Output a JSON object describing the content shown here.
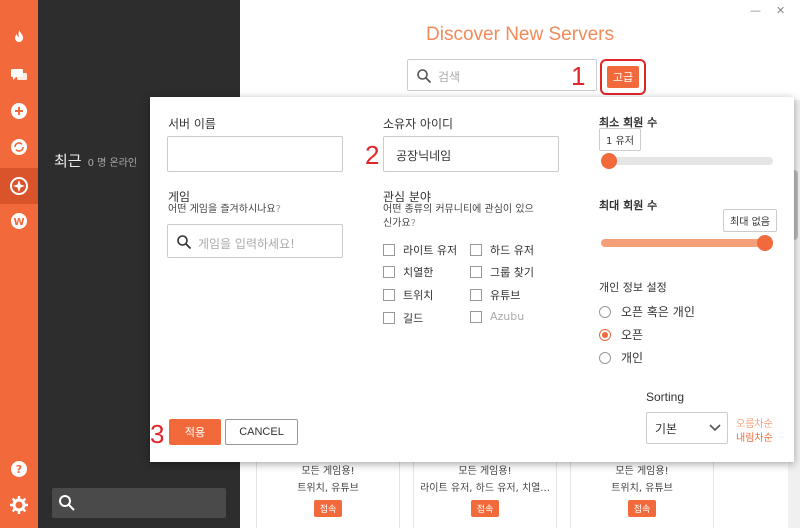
{
  "colors": {
    "accent": "#f26a3c",
    "annotation": "#e0262a",
    "title": "#f28a5a"
  },
  "rail": {
    "icons": [
      "flame-icon",
      "chat-icon",
      "plus-circle-icon",
      "sync-icon",
      "compass-icon",
      "w-badge-icon",
      "help-icon",
      "gear-icon"
    ]
  },
  "sidebar": {
    "recent_label": "최근",
    "online_count": "0 명 온라인"
  },
  "main": {
    "title": "Discover New Servers",
    "search_placeholder": "검색",
    "advanced_label": "고급",
    "cards": [
      {
        "line1": "모든 게임용!",
        "line2": "트위치, 유튜브",
        "join": "접속"
      },
      {
        "line1": "모든 게임용!",
        "line2": "라이트 유저, 하드 유저, 치열...",
        "join": "접속"
      },
      {
        "line1": "모든 게임용!",
        "line2": "트위치, 유튜브",
        "join": "접속"
      }
    ]
  },
  "annotations": {
    "one": "1",
    "two": "2",
    "three": "3"
  },
  "modal": {
    "server_name_label": "서버 이름",
    "server_name_value": "",
    "owner_id_label": "소유자 아이디",
    "owner_id_value": "공장닉네임",
    "game_label": "게임",
    "game_question": "어떤 게임을 즐겨하시나요",
    "game_q_mark": "?",
    "game_placeholder": "게임을 입력하세요!",
    "interest_label": "관심 분야",
    "interest_question_1": "어떤 종류의 커뮤니티에 관심이 있으",
    "interest_question_2": "신가요",
    "interest_q_mark": "?",
    "interests": [
      {
        "label": "라이트 유저",
        "enabled": true
      },
      {
        "label": "하드 유저",
        "enabled": true
      },
      {
        "label": "치열한",
        "enabled": true
      },
      {
        "label": "그룹 찾기",
        "enabled": true
      },
      {
        "label": "트위치",
        "enabled": true
      },
      {
        "label": "유튜브",
        "enabled": true
      },
      {
        "label": "길드",
        "enabled": true
      },
      {
        "label": "Azubu",
        "enabled": false
      }
    ],
    "min_members_label": "최소 회원 수",
    "min_members_value": "1 유저",
    "min_members_fraction": 0.0,
    "max_members_label": "최대 회원 수",
    "max_members_value": "최대 없음",
    "max_members_fraction": 1.0,
    "privacy_label": "개인 정보 설정",
    "privacy_options": [
      {
        "label": "오픈 혹은 개인",
        "selected": false
      },
      {
        "label": "오픈",
        "selected": true
      },
      {
        "label": "개인",
        "selected": false
      }
    ],
    "sorting_label": "Sorting",
    "sorting_value": "기본",
    "sort_asc": "오름차순",
    "sort_desc": "내림차순",
    "apply_label": "적용",
    "cancel_label": "CANCEL"
  }
}
